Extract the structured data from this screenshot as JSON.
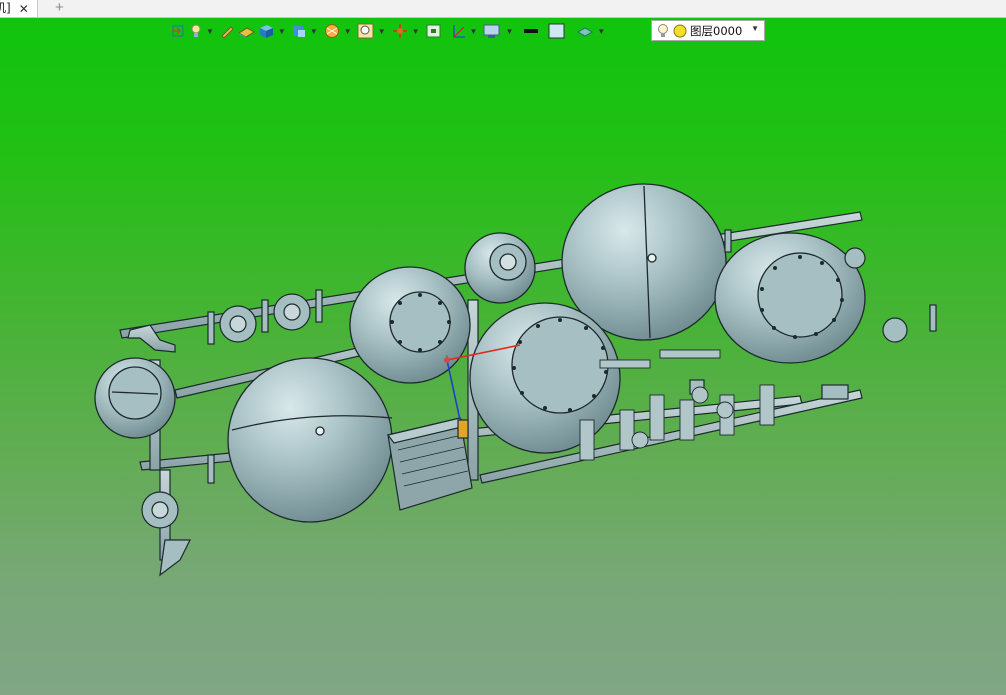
{
  "tab": {
    "title": "机]",
    "close_glyph": "✕",
    "add_glyph": "+"
  },
  "toolbar": {
    "items": [
      {
        "name": "import-icon"
      },
      {
        "name": "light-bulb-icon"
      },
      {
        "name": "pencil-icon"
      },
      {
        "name": "sheet-icon"
      },
      {
        "name": "cube-icon"
      },
      {
        "name": "view-cube-icon"
      },
      {
        "name": "render-icon"
      },
      {
        "name": "zoom-icon"
      },
      {
        "name": "pan-icon"
      },
      {
        "name": "fit-icon"
      },
      {
        "name": "section-icon"
      },
      {
        "name": "display-icon"
      },
      {
        "name": "line-color-icon"
      },
      {
        "name": "fill-color-icon"
      },
      {
        "name": "layer-icon"
      }
    ],
    "layer_select": {
      "value": "图层0000",
      "arrow": "▼"
    }
  },
  "colors": {
    "accent_bg_top": "#10c40d",
    "accent_bg_bottom": "#80a685",
    "model_fill": "#9fb9bd"
  }
}
